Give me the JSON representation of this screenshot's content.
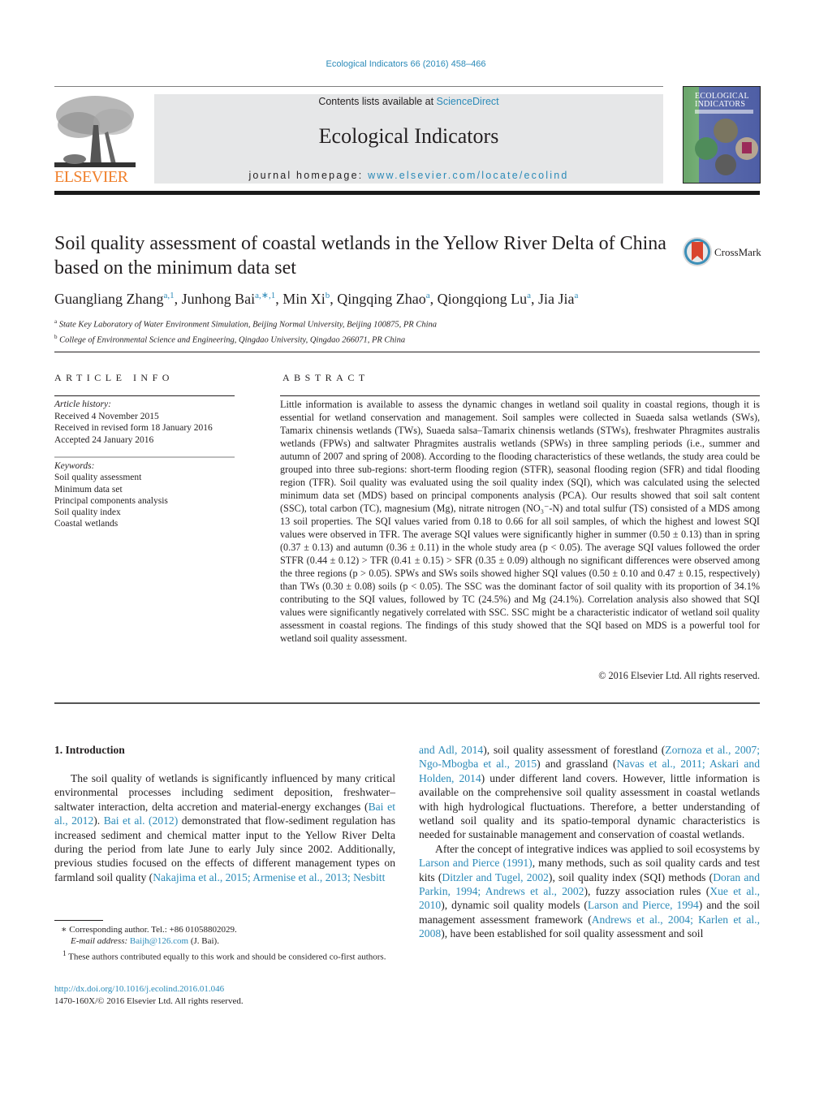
{
  "header": {
    "citation": "Ecological Indicators 66 (2016) 458–466",
    "contents_prefix": "Contents lists available at ",
    "contents_link": "ScienceDirect",
    "journal_name": "Ecological Indicators",
    "homepage_prefix": "journal homepage: ",
    "homepage_link": "www.elsevier.com/locate/ecolind",
    "publisher_logo_text": "ELSEVIER",
    "cover_title_line1": "ECOLOGICAL",
    "cover_title_line2": "INDICATORS",
    "crossmark_label": "CrossMark"
  },
  "article": {
    "title": "Soil quality assessment of coastal wetlands in the Yellow River Delta of China based on the minimum data set",
    "authors": [
      {
        "name": "Guangliang Zhang",
        "sup": "a,1"
      },
      {
        "name": "Junhong Bai",
        "sup": "a,∗,1"
      },
      {
        "name": "Min Xi",
        "sup": "b"
      },
      {
        "name": "Qingqing Zhao",
        "sup": "a"
      },
      {
        "name": "Qiongqiong Lu",
        "sup": "a"
      },
      {
        "name": "Jia Jia",
        "sup": "a"
      }
    ],
    "affiliations": [
      {
        "mark": "a",
        "text": "State Key Laboratory of Water Environment Simulation, Beijing Normal University, Beijing 100875, PR China"
      },
      {
        "mark": "b",
        "text": "College of Environmental Science and Engineering, Qingdao University, Qingdao 266071, PR China"
      }
    ]
  },
  "article_info": {
    "heading": "ARTICLE INFO",
    "history_label": "Article history:",
    "history": [
      "Received 4 November 2015",
      "Received in revised form 18 January 2016",
      "Accepted 24 January 2016"
    ],
    "keywords_label": "Keywords:",
    "keywords": [
      "Soil quality assessment",
      "Minimum data set",
      "Principal components analysis",
      "Soil quality index",
      "Coastal wetlands"
    ]
  },
  "abstract": {
    "heading": "ABSTRACT",
    "text": "Little information is available to assess the dynamic changes in wetland soil quality in coastal regions, though it is essential for wetland conservation and management. Soil samples were collected in Suaeda salsa wetlands (SWs), Tamarix chinensis wetlands (TWs), Suaeda salsa–Tamarix chinensis wetlands (STWs), freshwater Phragmites australis wetlands (FPWs) and saltwater Phragmites australis wetlands (SPWs) in three sampling periods (i.e., summer and autumn of 2007 and spring of 2008). According to the flooding characteristics of these wetlands, the study area could be grouped into three sub-regions: short-term flooding region (STFR), seasonal flooding region (SFR) and tidal flooding region (TFR). Soil quality was evaluated using the soil quality index (SQI), which was calculated using the selected minimum data set (MDS) based on principal components analysis (PCA). Our results showed that soil salt content (SSC), total carbon (TC), magnesium (Mg), nitrate nitrogen (NO₃⁻-N) and total sulfur (TS) consisted of a MDS among 13 soil properties. The SQI values varied from 0.18 to 0.66 for all soil samples, of which the highest and lowest SQI values were observed in TFR. The average SQI values were significantly higher in summer (0.50 ± 0.13) than in spring (0.37 ± 0.13) and autumn (0.36 ± 0.11) in the whole study area (p < 0.05). The average SQI values followed the order STFR (0.44 ± 0.12) > TFR (0.41 ± 0.15) > SFR (0.35 ± 0.09) although no significant differences were observed among the three regions (p > 0.05). SPWs and SWs soils showed higher SQI values (0.50 ± 0.10 and 0.47 ± 0.15, respectively) than TWs (0.30 ± 0.08) soils (p < 0.05). The SSC was the dominant factor of soil quality with its proportion of 34.1% contributing to the SQI values, followed by TC (24.5%) and Mg (24.1%). Correlation analysis also showed that SQI values were significantly negatively correlated with SSC. SSC might be a characteristic indicator of wetland soil quality assessment in coastal regions. The findings of this study showed that the SQI based on MDS is a powerful tool for wetland soil quality assessment.",
    "copyright": "© 2016 Elsevier Ltd. All rights reserved."
  },
  "intro": {
    "heading": "1.  Introduction",
    "left_p1": [
      {
        "t": "The soil quality of wetlands is significantly influenced by many critical environmental processes including sediment deposition, freshwater–saltwater interaction, delta accretion and material-energy exchanges ("
      },
      {
        "l": "Bai et al., 2012"
      },
      {
        "t": "). "
      },
      {
        "l": "Bai et al. (2012)"
      },
      {
        "t": " demonstrated that flow-sediment regulation has increased sediment and chemical matter input to the Yellow River Delta during the period from late June to early July since 2002. Additionally, previous studies focused on the effects of different management types on farmland soil quality ("
      },
      {
        "l": "Nakajima et al., 2015; Armenise et al., 2013; Nesbitt"
      }
    ],
    "right_p1": [
      {
        "l": "and Adl, 2014"
      },
      {
        "t": "), soil quality assessment of forestland ("
      },
      {
        "l": "Zornoza et al., 2007; Ngo-Mbogba et al., 2015"
      },
      {
        "t": ") and grassland ("
      },
      {
        "l": "Navas et al., 2011; Askari and Holden, 2014"
      },
      {
        "t": ") under different land covers. However, little information is available on the comprehensive soil quality assessment in coastal wetlands with high hydrological fluctuations. Therefore, a better understanding of wetland soil quality and its spatio-temporal dynamic characteristics is needed for sustainable management and conservation of coastal wetlands."
      }
    ],
    "right_p2": [
      {
        "t": "After the concept of integrative indices was applied to soil ecosystems by "
      },
      {
        "l": "Larson and Pierce (1991)"
      },
      {
        "t": ", many methods, such as soil quality cards and test kits ("
      },
      {
        "l": "Ditzler and Tugel, 2002"
      },
      {
        "t": "), soil quality index (SQI) methods ("
      },
      {
        "l": "Doran and Parkin, 1994; Andrews et al., 2002"
      },
      {
        "t": "), fuzzy association rules ("
      },
      {
        "l": "Xue et al., 2010"
      },
      {
        "t": "), dynamic soil quality models ("
      },
      {
        "l": "Larson and Pierce, 1994"
      },
      {
        "t": ") and the soil management assessment framework ("
      },
      {
        "l": "Andrews et al., 2004; Karlen et al., 2008"
      },
      {
        "t": "), have been established for soil quality assessment and soil"
      }
    ]
  },
  "footnotes": {
    "corresponding": "∗  Corresponding author. Tel.: +86 01058802029.",
    "email_label": "E-mail address: ",
    "email": "Baijh@126.com",
    "email_suffix": " (J. Bai).",
    "equal_contrib_mark": "1",
    "equal_contrib": " These authors contributed equally to this work and should be considered co-first authors.",
    "doi": "http://dx.doi.org/10.1016/j.ecolind.2016.01.046",
    "issn": "1470-160X/© 2016 Elsevier Ltd. All rights reserved."
  }
}
